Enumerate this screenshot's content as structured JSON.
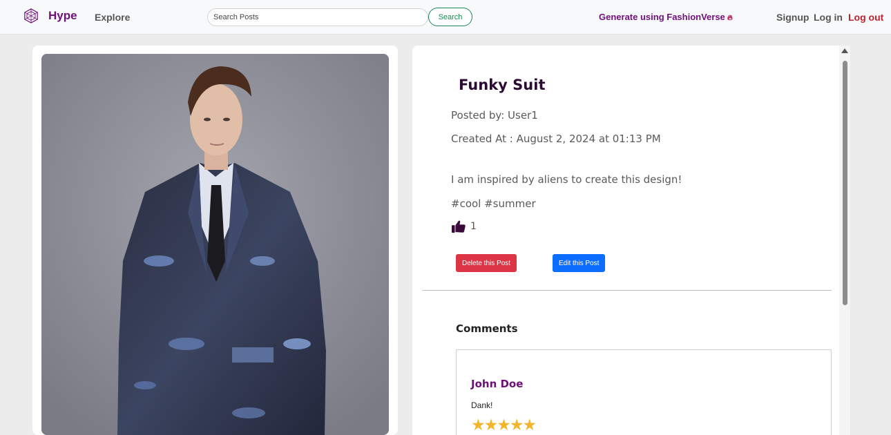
{
  "navbar": {
    "brand": "Hype",
    "explore": "Explore",
    "search_placeholder": "Search Posts",
    "search_button": "Search",
    "generate": "Generate using FashionVerse",
    "generate_icon": "flame-icon",
    "signup": "Signup",
    "login": "Log in",
    "logout": "Log out"
  },
  "post": {
    "title": "Funky Suit",
    "posted_by": "Posted by: User1",
    "created_at": "Created At : August 2, 2024 at 01:13 PM",
    "description": "I am inspired by aliens to create this design!",
    "tags": "#cool #summer",
    "likes": "1",
    "like_icon": "thumbs-up-icon",
    "delete_button": "Delete this Post",
    "edit_button": "Edit this Post"
  },
  "comments": {
    "heading": "Comments",
    "items": [
      {
        "author": "John Doe",
        "text": "Dank!",
        "stars": "★★★★★",
        "rating": 5
      }
    ]
  },
  "colors": {
    "brand": "#6f0f7a",
    "logout": "#c0202e",
    "delete": "#dc3545",
    "edit": "#0d6efd",
    "search": "#198754",
    "stars": "#f3b52b"
  }
}
